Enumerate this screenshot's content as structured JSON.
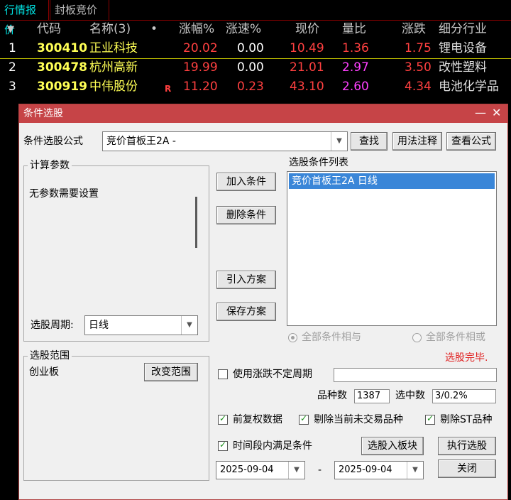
{
  "tabs": {
    "active": "行情报价",
    "second": "封板竞价"
  },
  "table": {
    "sort_icon": "▼",
    "headers": {
      "code": "代码",
      "name": "名称(3)",
      "dot": "•",
      "change_pct": "涨幅%",
      "speed": "涨速%",
      "price": "现价",
      "vol_ratio": "量比",
      "change": "涨跌",
      "industry": "细分行业"
    },
    "rows": [
      {
        "idx": "1",
        "code": "300410",
        "name": "正业科技",
        "flag": "",
        "change_pct": "20.02",
        "speed": "0.00",
        "price": "10.49",
        "vol_ratio": "1.36",
        "change": "1.75",
        "industry": "锂电设备"
      },
      {
        "idx": "2",
        "code": "300478",
        "name": "杭州高新",
        "flag": "",
        "change_pct": "19.99",
        "speed": "0.00",
        "price": "21.01",
        "vol_ratio": "2.97",
        "change": "3.50",
        "industry": "改性塑料"
      },
      {
        "idx": "3",
        "code": "300919",
        "name": "中伟股份",
        "flag": "R",
        "change_pct": "11.20",
        "speed": "0.23",
        "price": "43.10",
        "vol_ratio": "2.60",
        "change": "4.34",
        "industry": "电池化学品"
      }
    ],
    "colors": {
      "up": "#ff4040",
      "code": "#ffff55",
      "vol_ratio_high": "#ff40ff"
    }
  },
  "dialog": {
    "title": "条件选股",
    "minimize": "—",
    "close": "✕",
    "formula_label": "条件选股公式",
    "formula_value": "竞价首板王2A  -",
    "btn_find": "查找",
    "btn_usage": "用法注释",
    "btn_view": "查看公式",
    "params_group": "计算参数",
    "params_text": "无参数需要设置",
    "period_label": "选股周期:",
    "period_value": "日线",
    "btn_add": "加入条件",
    "btn_delete": "删除条件",
    "btn_import": "引入方案",
    "btn_save": "保存方案",
    "cond_list_label": "选股条件列表",
    "cond_items": [
      "竞价首板王2A  日线"
    ],
    "radio_and": "全部条件相与",
    "radio_or": "全部条件相或",
    "status": "选股完毕.",
    "range_group": "选股范围",
    "range_value": "创业板",
    "btn_change_range": "改变范围",
    "use_variable_period": "使用涨跌不定周期",
    "variable_period_value": "",
    "count_label": "品种数",
    "count_value": "1387",
    "selected_label": "选中数",
    "selected_value": "3/0.2%",
    "chk_adjust": "前复权数据",
    "chk_exclude_untraded": "剔除当前未交易品种",
    "chk_exclude_st": "剔除ST品种",
    "chk_period": "时间段内满足条件",
    "btn_to_block": "选股入板块",
    "btn_execute": "执行选股",
    "date_from": "2025-09-04",
    "date_sep": "-",
    "date_to": "2025-09-04",
    "btn_close": "关闭",
    "check_mark": "✓",
    "dropdown_arrow": "▼"
  }
}
